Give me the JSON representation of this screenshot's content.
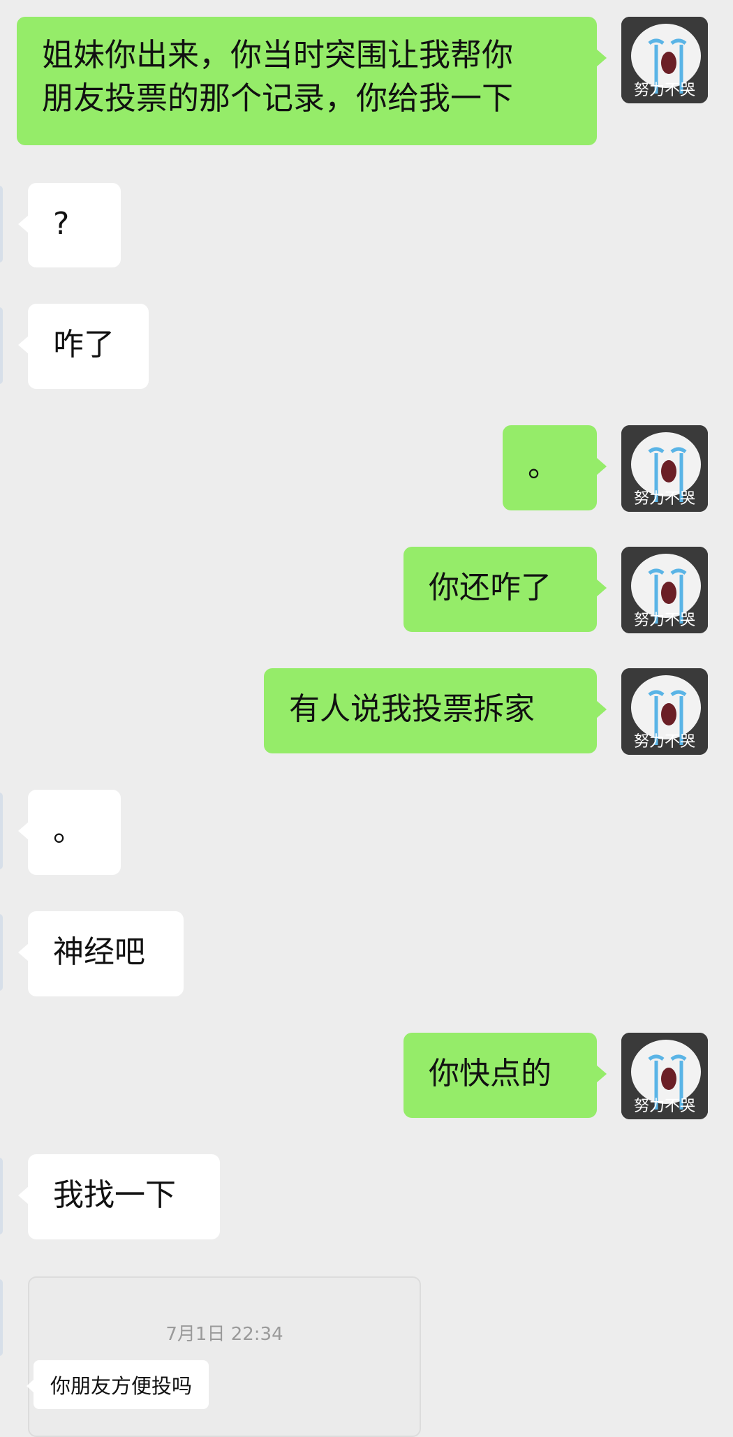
{
  "avatar": {
    "caption": "努力不哭",
    "icon": "crying-snowball-avatar"
  },
  "messages": [
    {
      "sender": "me",
      "lines": [
        "姐妹你出来，你当时突围让我帮你",
        "朋友投票的那个记录，你给我一下"
      ]
    },
    {
      "sender": "them",
      "text": "?"
    },
    {
      "sender": "them",
      "text": "咋了"
    },
    {
      "sender": "me",
      "text": "。"
    },
    {
      "sender": "me",
      "text": "你还咋了"
    },
    {
      "sender": "me",
      "text": "有人说我投票拆家"
    },
    {
      "sender": "them",
      "text": "。"
    },
    {
      "sender": "them",
      "text": "神经吧"
    },
    {
      "sender": "me",
      "text": "你快点的"
    },
    {
      "sender": "them",
      "text": "我找一下"
    }
  ],
  "screenshot_card": {
    "timestamp": "7月1日 22:34",
    "message": "你朋友方便投吗"
  },
  "colors": {
    "background": "#ededed",
    "my_bubble": "#95ec69",
    "their_bubble": "#ffffff"
  }
}
